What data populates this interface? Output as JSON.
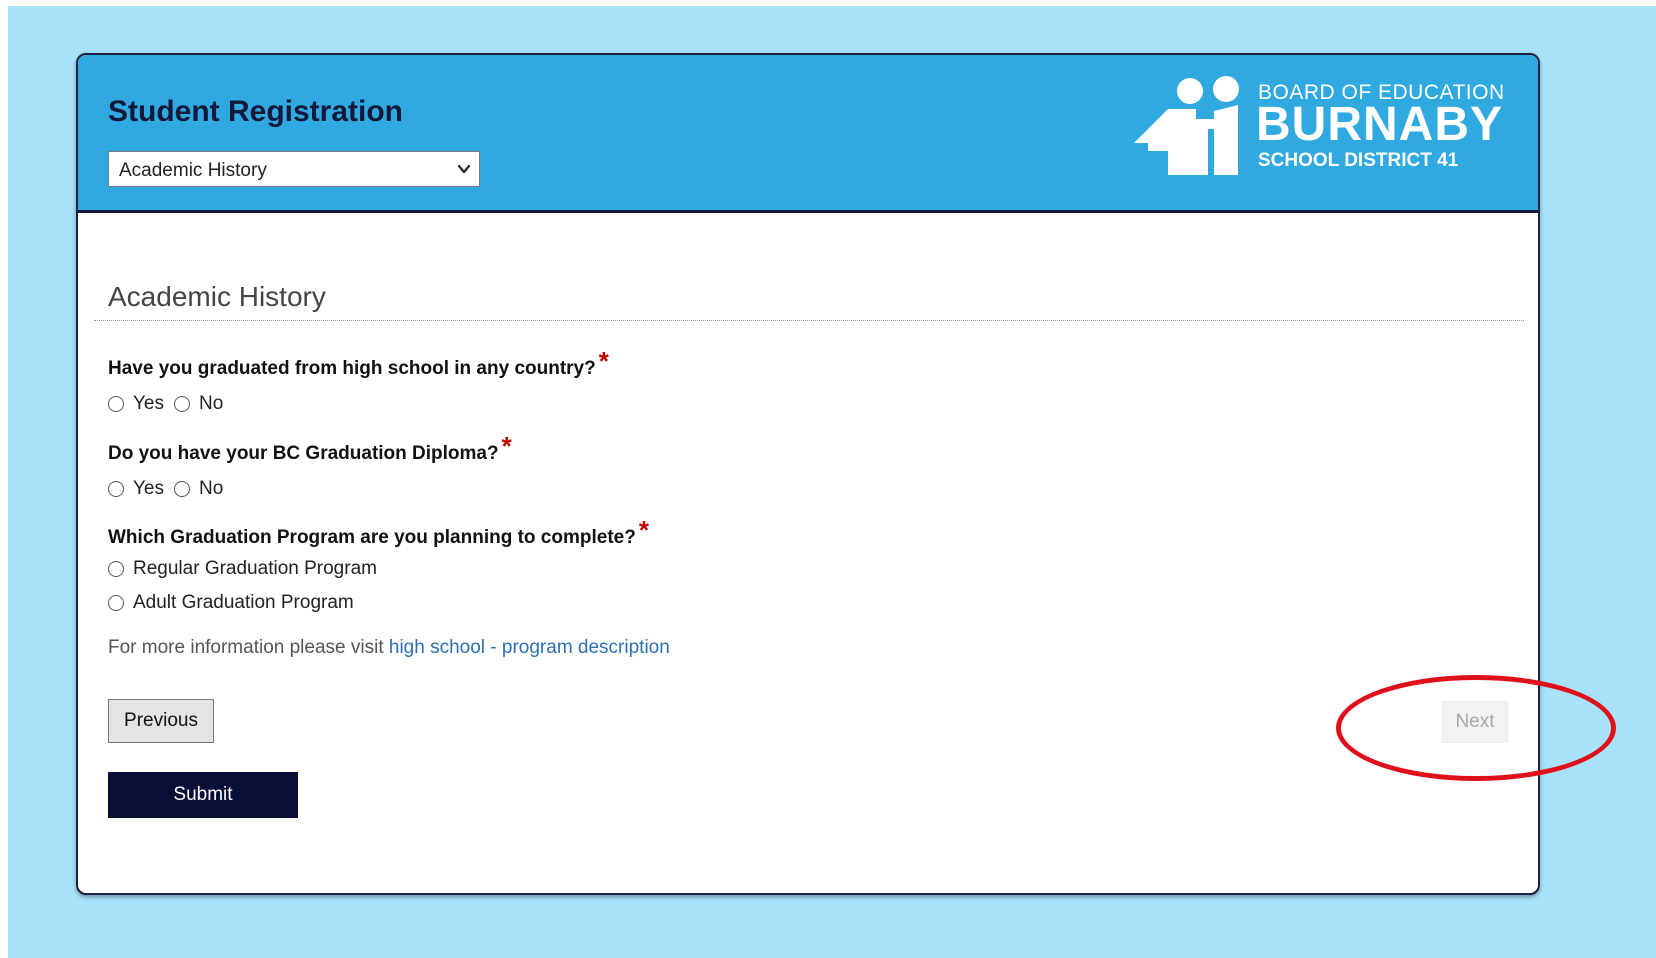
{
  "header": {
    "title": "Student Registration",
    "section_select": {
      "selected": "Academic History"
    },
    "logo": {
      "line1": "BOARD OF EDUCATION",
      "line2": "BURNABY",
      "line3": "SCHOOL DISTRICT 41"
    }
  },
  "section": {
    "heading": "Academic History"
  },
  "questions": [
    {
      "text": "Have you graduated from high school in any country?",
      "required_mark": "*",
      "options": [
        "Yes",
        "No"
      ]
    },
    {
      "text": "Do you have your BC Graduation Diploma?",
      "required_mark": "*",
      "options": [
        "Yes",
        "No"
      ]
    },
    {
      "text": "Which Graduation Program are you planning to complete?",
      "required_mark": "*",
      "options": [
        "Regular Graduation Program",
        "Adult Graduation Program"
      ]
    }
  ],
  "info": {
    "prefix": "For more information please visit ",
    "link_text": "high school - program description"
  },
  "buttons": {
    "previous": "Previous",
    "next": "Next",
    "submit": "Submit"
  },
  "colors": {
    "page_background": "#a8e2fb",
    "header_background": "#2fa9e0",
    "navy": "#14193a",
    "submit_background": "#0b0e36",
    "required_star": "#c00000",
    "link": "#2d6fb3",
    "annotation_red": "#e0101a"
  }
}
